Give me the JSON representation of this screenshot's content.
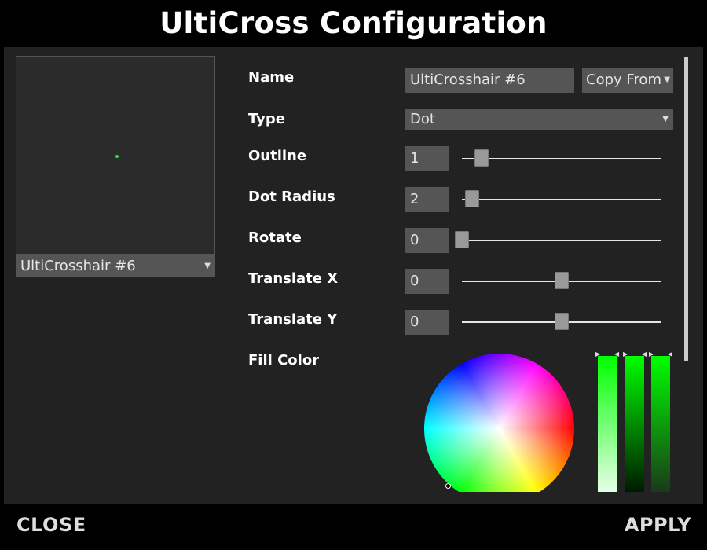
{
  "window": {
    "title": "UltiCross Configuration"
  },
  "preview": {
    "dot_color": "#2ee02e",
    "selector_value": "UltiCrosshair #6"
  },
  "form": {
    "name": {
      "label": "Name",
      "value": "UltiCrosshair #6",
      "copy_from_label": "Copy From"
    },
    "type": {
      "label": "Type",
      "value": "Dot"
    },
    "outline": {
      "label": "Outline",
      "value": "1",
      "slider_fraction": 0.1
    },
    "dot_radius": {
      "label": "Dot Radius",
      "value": "2",
      "slider_fraction": 0.05
    },
    "rotate": {
      "label": "Rotate",
      "value": "0",
      "slider_fraction": 0.0
    },
    "translate_x": {
      "label": "Translate X",
      "value": "0",
      "slider_fraction": 0.5
    },
    "translate_y": {
      "label": "Translate Y",
      "value": "0",
      "slider_fraction": 0.5
    },
    "fill_color": {
      "label": "Fill Color",
      "hue_color": "#00ff00"
    }
  },
  "footer": {
    "close_label": "CLOSE",
    "apply_label": "APPLY"
  },
  "icons": {
    "dropdown": "caret-down-icon",
    "slider_marker": "triangle-icon"
  }
}
